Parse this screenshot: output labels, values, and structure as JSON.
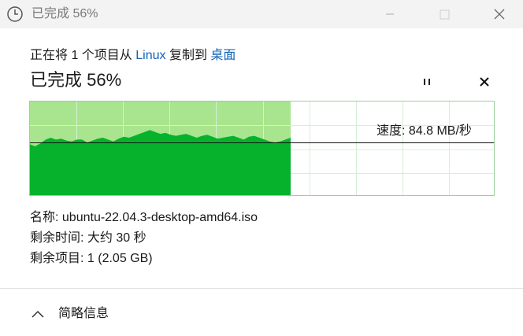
{
  "window": {
    "title": "已完成 56%",
    "icon": "clock-icon"
  },
  "copy": {
    "from_prefix": "正在将 1 个项目从",
    "source": "Linux",
    "middle": "复制到",
    "destination": "桌面",
    "status": "已完成 56%",
    "progress_percent": 56,
    "speed_label": "速度: 84.8 MB/秒"
  },
  "details": {
    "name_label": "名称:",
    "name_value": "ubuntu-22.04.3-desktop-amd64.iso",
    "time_label": "剩余时间:",
    "time_value": "大约 30 秒",
    "items_label": "剩余项目:",
    "items_value": "1 (2.05 GB)"
  },
  "footer": {
    "toggle_label": "简略信息"
  },
  "colors": {
    "fill_light": "#a8e58e",
    "fill_dark": "#06b22c",
    "grid": "#d6efd6",
    "link": "#0f62b8"
  }
}
